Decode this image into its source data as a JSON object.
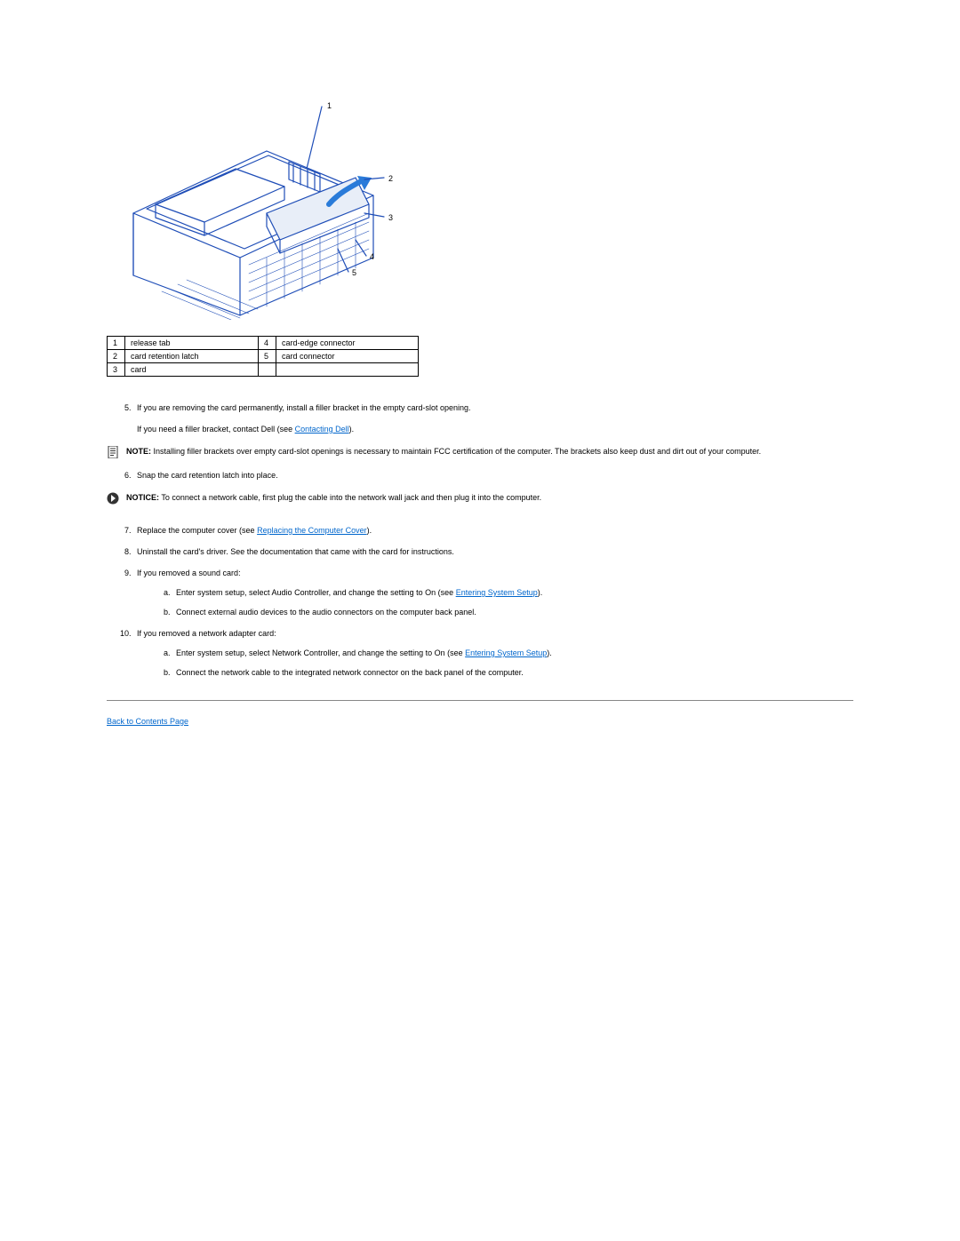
{
  "diagram": {
    "callouts": {
      "c1": "1",
      "c2": "2",
      "c3": "3",
      "c4": "4",
      "c5": "5"
    }
  },
  "legend": {
    "r1c1": "1",
    "r1c2": "release tab",
    "r1c3": "4",
    "r1c4": "card-edge connector",
    "r2c1": "2",
    "r2c2": "card retention latch",
    "r2c3": "5",
    "r2c4": "card connector",
    "r3c1": "3",
    "r3c2": "card",
    "r3c3": "",
    "r3c4": ""
  },
  "steps": {
    "s5a": "If you are removing the card permanently, install a filler bracket in the empty card-slot opening.",
    "s5b_pre": "If you need a filler bracket, contact Dell (see ",
    "s5b_link": "Contacting Dell",
    "s5b_post": ").",
    "s6": "Snap the card retention latch into place.",
    "s7_pre": "Replace the computer cover (see ",
    "s7_link": "Replacing the Computer Cover",
    "s7_post": ").",
    "s8": "Uninstall the card's driver. See the documentation that came with the card for instructions.",
    "s9": "If you removed a sound card:",
    "s9a_pre": "Enter system setup, select Audio Controller, and change the setting to On (see ",
    "s9a_link": "Entering System Setup",
    "s9a_post": ").",
    "s9b": "Connect external audio devices to the audio connectors on the computer back panel.",
    "s10": "If you removed a network adapter card:",
    "s10a_pre": "Enter system setup, select Network Controller, and change the setting to On (see ",
    "s10a_link": "Entering System Setup",
    "s10a_post": ").",
    "s10b": "Connect the network cable to the integrated network connector on the back panel of the computer."
  },
  "callouts_blocks": {
    "note_label": "NOTE:",
    "note_text": " Installing filler brackets over empty card-slot openings is necessary to maintain FCC certification of the computer. The brackets also keep dust and dirt out of your computer.",
    "notice_label": "NOTICE:",
    "notice_text": " To connect a network cable, first plug the cable into the network wall jack and then plug it into the computer."
  },
  "footer": {
    "back_link": "Back to Contents Page"
  }
}
